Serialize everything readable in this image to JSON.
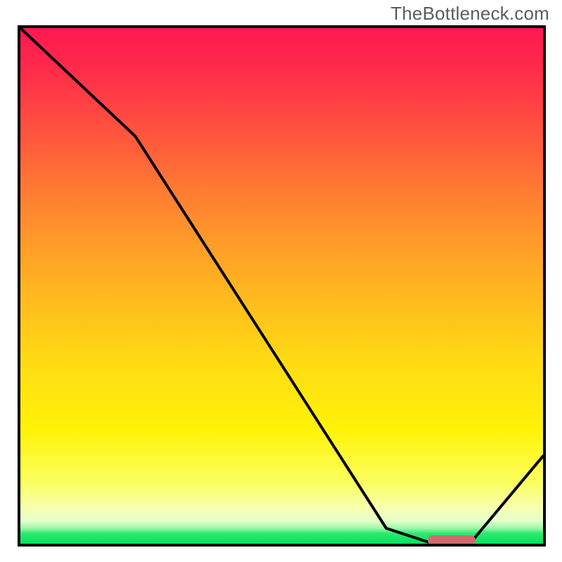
{
  "watermark": "TheBottleneck.com",
  "chart_data": {
    "type": "line",
    "title": "",
    "xlabel": "",
    "ylabel": "",
    "xlim": [
      0,
      100
    ],
    "ylim": [
      0,
      100
    ],
    "grid": false,
    "series": [
      {
        "name": "bottleneck-curve",
        "x": [
          0,
          22,
          70,
          79,
          86,
          100
        ],
        "values": [
          100,
          79,
          3,
          0,
          0,
          17
        ]
      }
    ],
    "marker_segment": {
      "x_start": 79,
      "x_end": 86,
      "y": 0
    },
    "gradient_stops": [
      {
        "pct": 0,
        "color": "#ff1850"
      },
      {
        "pct": 22,
        "color": "#ff5a3c"
      },
      {
        "pct": 50,
        "color": "#ffb421"
      },
      {
        "pct": 78,
        "color": "#fff308"
      },
      {
        "pct": 93,
        "color": "#f7ffae"
      },
      {
        "pct": 100,
        "color": "#00e65a"
      }
    ]
  },
  "colors": {
    "curve": "#000000",
    "frame": "#000000",
    "marker": "#cf6a6c",
    "watermark": "#5c5c5c"
  }
}
